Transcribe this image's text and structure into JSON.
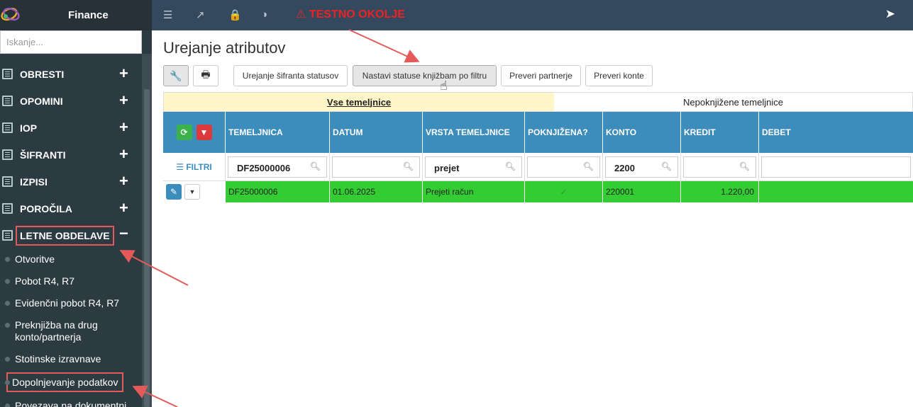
{
  "app": {
    "brand": "Finance",
    "environment_warning": "TESTNO OKOLJE"
  },
  "search": {
    "placeholder": "Iskanje..."
  },
  "menu": {
    "items": [
      {
        "label": "OBRESTI",
        "toggle": "+"
      },
      {
        "label": "OPOMINI",
        "toggle": "+"
      },
      {
        "label": "IOP",
        "toggle": "+"
      },
      {
        "label": "ŠIFRANTI",
        "toggle": "+"
      },
      {
        "label": "IZPISI",
        "toggle": "+"
      },
      {
        "label": "POROČILA",
        "toggle": "+"
      },
      {
        "label": "LETNE OBDELAVE",
        "toggle": "−"
      }
    ],
    "sub_items": [
      "Otvoritve",
      "Pobot R4, R7",
      "Evidenčni pobot R4, R7",
      "Preknjižba na drug",
      "konto/partnerja",
      "Stotinske izravnave",
      "Dopolnjevanje podatkov",
      "Povezava na dokumentni"
    ]
  },
  "page": {
    "title": "Urejanje atributov"
  },
  "toolbar": {
    "buttons": [
      "Urejanje šifranta statusov",
      "Nastavi statuse knjižbam po filtru",
      "Preveri partnerje",
      "Preveri konte"
    ]
  },
  "tabs": {
    "active": "Vse temeljnice",
    "inactive": "Nepoknjižene temeljnice"
  },
  "grid": {
    "filters_label": "FILTRI",
    "columns": [
      "TEMELJNICA",
      "DATUM",
      "VRSTA TEMELJNICE",
      "POKNJIŽENA?",
      "KONTO",
      "KREDIT",
      "DEBET"
    ],
    "filters": {
      "temeljnica": "DF25000006",
      "vrsta": "prejet",
      "konto": "2200"
    },
    "rows": [
      {
        "temeljnica": "DF25000006",
        "datum": "01.06.2025",
        "vrsta": "Prejeti račun",
        "poknjizena": "✓",
        "konto": "220001",
        "kredit": "1.220,00",
        "debet": ""
      }
    ]
  },
  "colors": {
    "header_blue": "#3c8dbc",
    "row_green": "#33cc33",
    "active_tab": "#fff6c9",
    "annotation_red": "#e45a5a"
  }
}
